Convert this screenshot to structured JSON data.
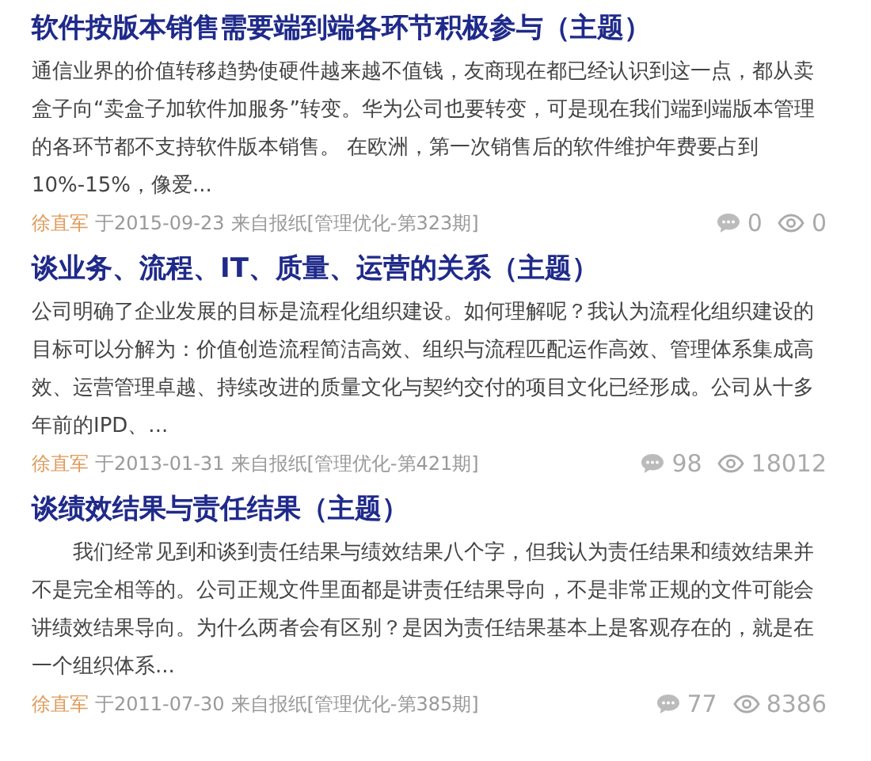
{
  "articles": [
    {
      "title": "软件按版本销售需要端到端各环节积极参与（主题）",
      "summary": "通信业界的价值转移趋势使硬件越来越不值钱，友商现在都已经认识到这一点，都从卖盒子向“卖盒子加软件加服务”转变。华为公司也要转变，可是现在我们端到端版本管理的各环节都不支持软件版本销售。 在欧洲，第一次销售后的软件维护年费要占到10%-15%，像爱...",
      "author": "徐直军",
      "date": "于2015-09-23",
      "source": "来自报纸[管理优化-第323期]",
      "comments": "0",
      "views": "0"
    },
    {
      "title": "谈业务、流程、IT、质量、运营的关系（主题）",
      "summary": "公司明确了企业发展的目标是流程化组织建设。如何理解呢？我认为流程化组织建设的目标可以分解为：价值创造流程简洁高效、组织与流程匹配运作高效、管理体系集成高效、运营管理卓越、持续改进的质量文化与契约交付的项目文化已经形成。公司从十多年前的IPD、...",
      "author": "徐直军",
      "date": "于2013-01-31",
      "source": "来自报纸[管理优化-第421期]",
      "comments": "98",
      "views": "18012"
    },
    {
      "title": "谈绩效结果与责任结果（主题）",
      "summary": "　　我们经常见到和谈到责任结果与绩效结果八个字，但我认为责任结果和绩效结果并不是完全相等的。公司正规文件里面都是讲责任结果导向，不是非常正规的文件可能会讲绩效结果导向。为什么两者会有区别？是因为责任结果基本上是客观存在的，就是在一个组织体系...",
      "author": "徐直军",
      "date": "于2011-07-30",
      "source": "来自报纸[管理优化-第385期]",
      "comments": "77",
      "views": "8386"
    }
  ]
}
